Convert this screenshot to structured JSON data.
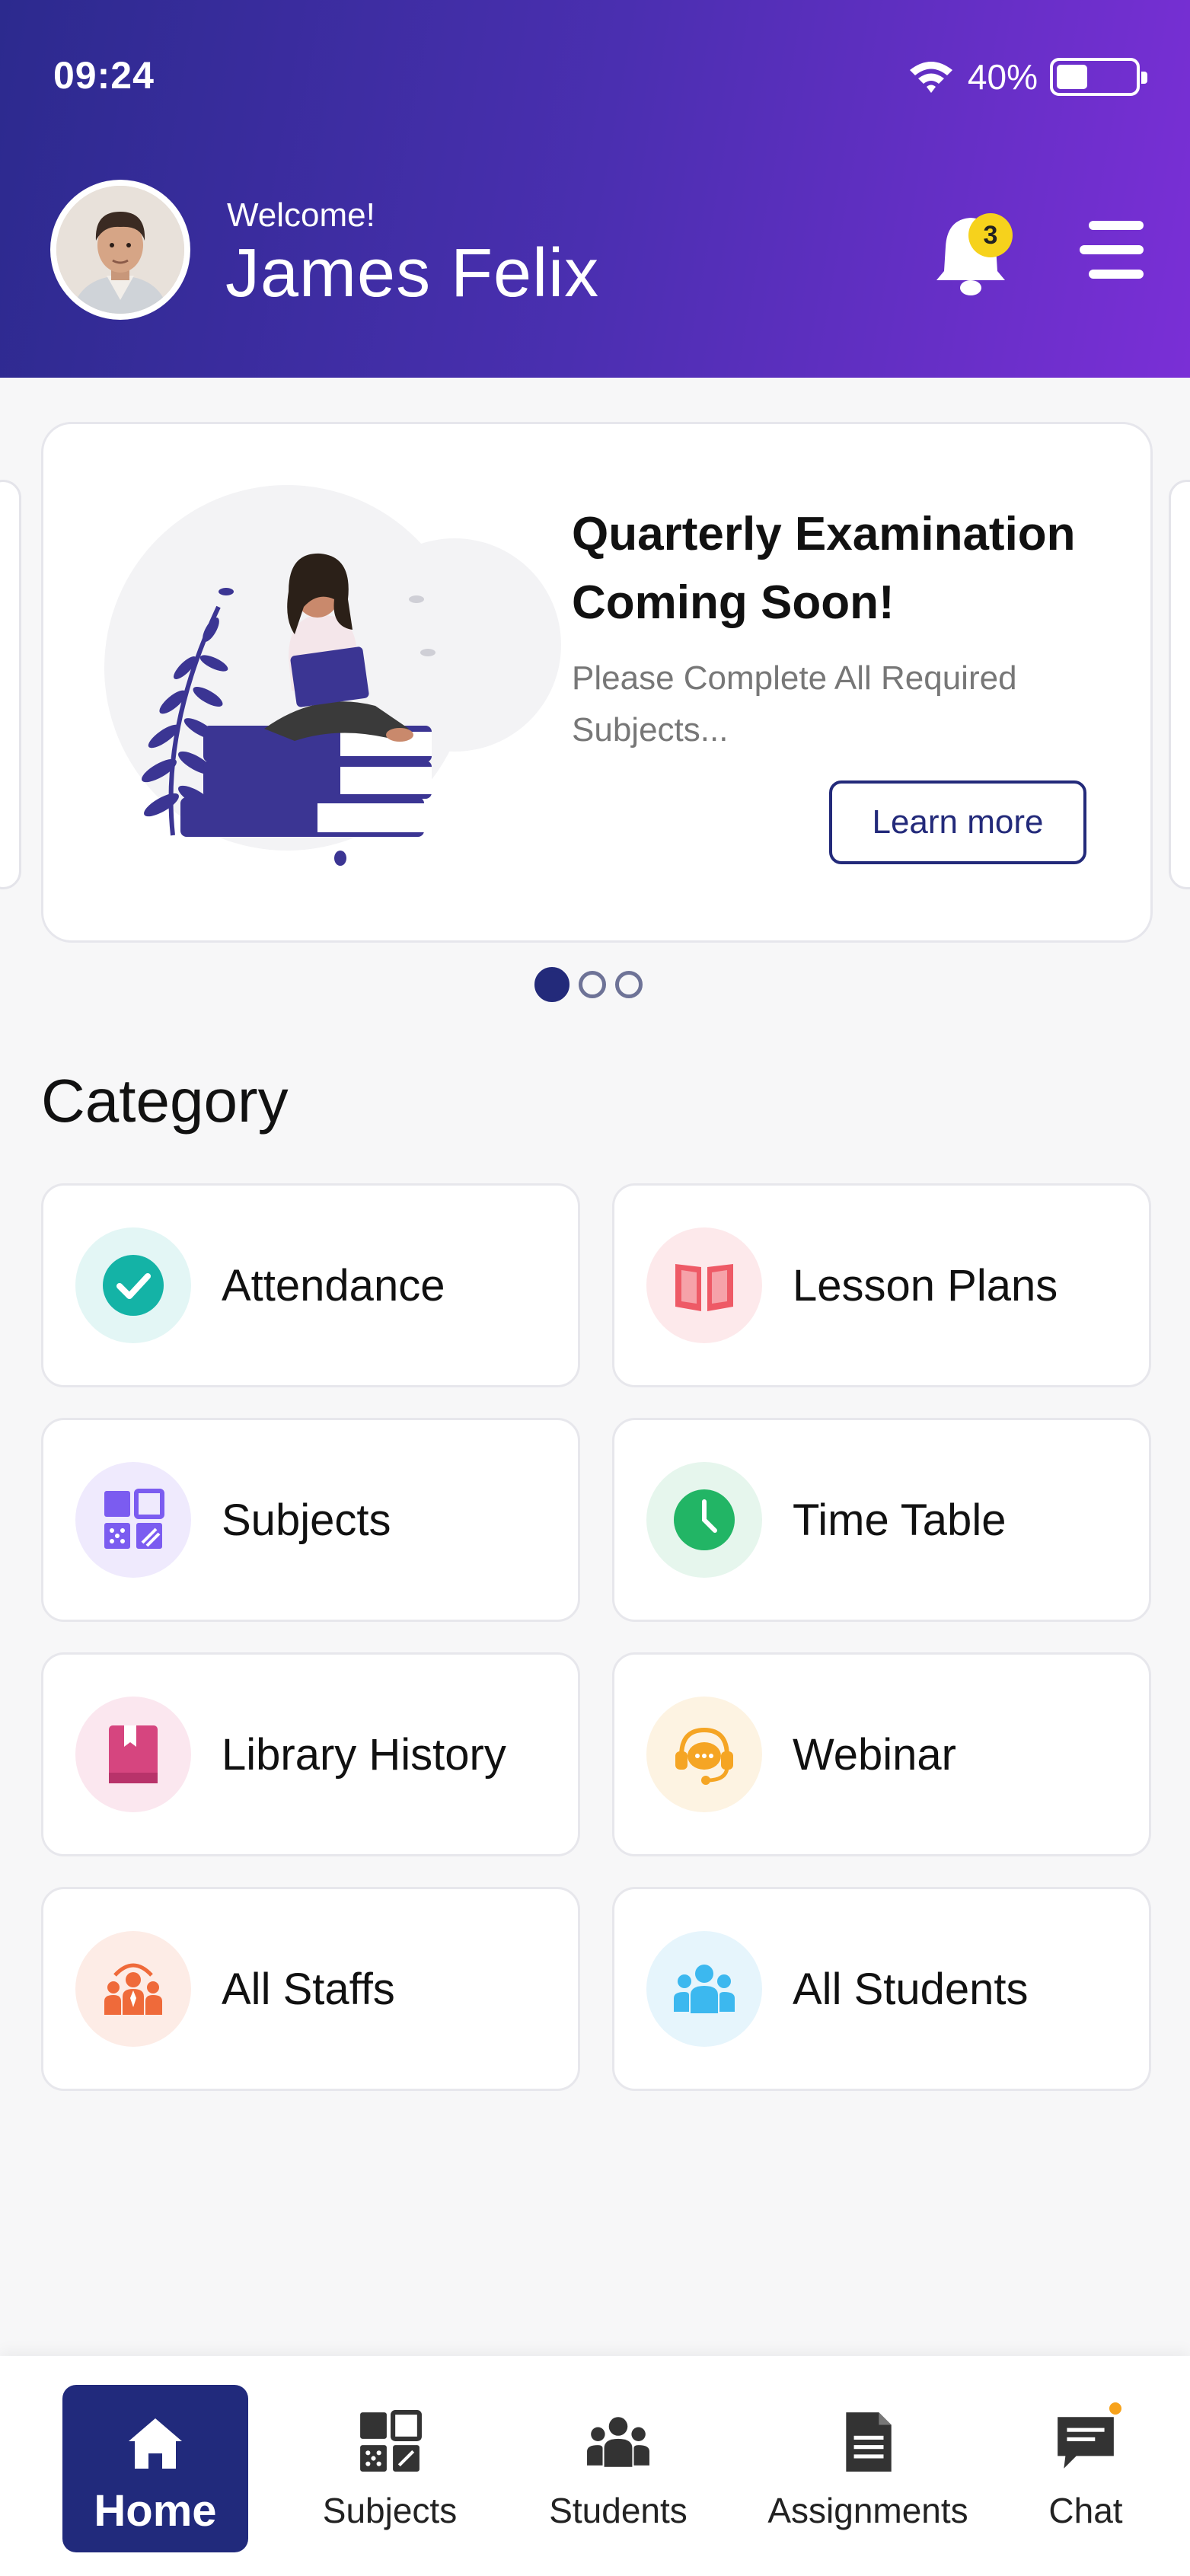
{
  "status_bar": {
    "time": "09:24",
    "battery": "40%",
    "battery_level": 0.4
  },
  "header": {
    "welcome": "Welcome!",
    "user_name": "James Felix",
    "notification_count": "3"
  },
  "banner": {
    "title": "Quarterly Examination Coming Soon!",
    "subtitle": "Please Complete All Required Subjects...",
    "button": "Learn more",
    "page_count": 3,
    "active_page": 1
  },
  "category": {
    "title": "Category",
    "items": [
      {
        "label": "Attendance",
        "icon": "check-circle-icon",
        "color": "#14b3a6",
        "bg": "#e3f6f5"
      },
      {
        "label": "Lesson Plans",
        "icon": "open-book-icon",
        "color": "#ee5a66",
        "bg": "#fde9eb"
      },
      {
        "label": "Subjects",
        "icon": "subjects-grid-icon",
        "color": "#7b5cf0",
        "bg": "#efeafd"
      },
      {
        "label": "Time Table",
        "icon": "clock-icon",
        "color": "#22b565",
        "bg": "#e6f6ed"
      },
      {
        "label": "Library History",
        "icon": "book-icon",
        "color": "#d6457f",
        "bg": "#fbe7ef"
      },
      {
        "label": "Webinar",
        "icon": "headset-chat-icon",
        "color": "#f5a524",
        "bg": "#fdf3e2"
      },
      {
        "label": "All Staffs",
        "icon": "staff-group-icon",
        "color": "#ef6a3a",
        "bg": "#fdece6"
      },
      {
        "label": "All Students",
        "icon": "students-group-icon",
        "color": "#3cb8ef",
        "bg": "#e6f5fc"
      }
    ]
  },
  "bottom_nav": {
    "items": [
      {
        "label": "Home",
        "icon": "home-icon",
        "active": true
      },
      {
        "label": "Subjects",
        "icon": "subjects-grid-icon"
      },
      {
        "label": "Students",
        "icon": "students-group-icon"
      },
      {
        "label": "Assignments",
        "icon": "document-icon"
      },
      {
        "label": "Chat",
        "icon": "chat-icon",
        "has_badge": true
      }
    ]
  },
  "colors": {
    "primary": "#212a7c",
    "header_start": "#2c2a8e",
    "header_end": "#7a2fd6"
  }
}
